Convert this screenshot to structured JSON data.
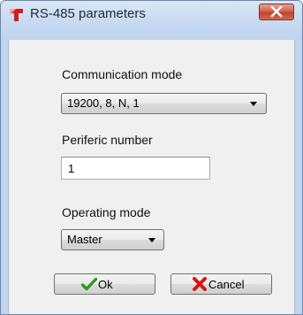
{
  "window": {
    "title": "RS-485 parameters",
    "app_icon": "red-arrow-icon",
    "close_icon": "close-icon"
  },
  "communication_mode": {
    "label": "Communication mode",
    "selected": "19200, 8, N, 1"
  },
  "periferic_number": {
    "label": "Periferic number",
    "value": "1"
  },
  "operating_mode": {
    "label": "Operating mode",
    "selected": "Master"
  },
  "buttons": {
    "ok": {
      "label": "Ok",
      "icon": "checkmark-icon"
    },
    "cancel": {
      "label": "Cancel",
      "icon": "red-x-icon"
    }
  },
  "colors": {
    "title_bar": "#c9dbf1",
    "close_button": "#c1442d",
    "client": "#f0f0f0"
  }
}
